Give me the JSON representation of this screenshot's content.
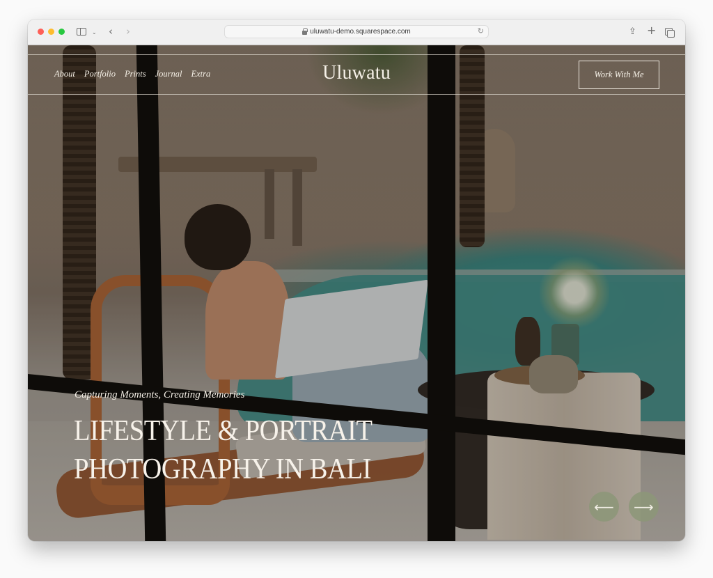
{
  "browser": {
    "url": "uluwatu-demo.squarespace.com",
    "icons": {
      "close": "close-dot",
      "minimize": "minimize-dot",
      "maximize": "maximize-dot",
      "sidebar": "sidebar-icon",
      "chevron": "chevron-down-icon",
      "back": "back-arrow-icon",
      "forward": "forward-arrow-icon",
      "lock": "lock-icon",
      "reload": "reload-icon",
      "share": "share-icon",
      "new_tab": "plus-icon",
      "tab_overview": "tabs-icon"
    },
    "glyphs": {
      "chevron": "⌄",
      "back": "‹",
      "forward": "›",
      "reload": "↻",
      "share": "⇪",
      "new_tab": "+"
    }
  },
  "site": {
    "logo": "Uluwatu",
    "nav": [
      {
        "label": "About"
      },
      {
        "label": "Portfolio"
      },
      {
        "label": "Prints"
      },
      {
        "label": "Journal"
      },
      {
        "label": "Extra"
      }
    ],
    "cta_label": "Work With Me"
  },
  "hero": {
    "tagline": "Capturing Moments, Creating Memories",
    "headline_line1": "LIFESTYLE & PORTRAIT",
    "headline_line2": "PHOTOGRAPHY IN BALI",
    "prev_glyph": "⟵",
    "next_glyph": "⟶",
    "button_color": "#8c9678"
  }
}
